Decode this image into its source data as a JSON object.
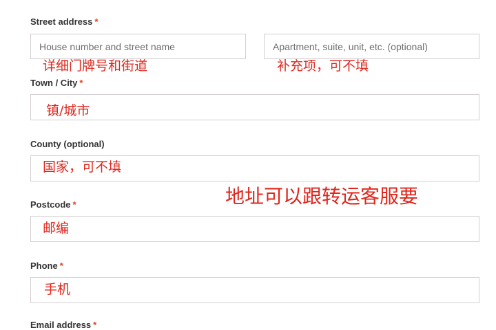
{
  "street": {
    "label": "Street address",
    "required_mark": "*",
    "line1_placeholder": "House number and street name",
    "line2_placeholder": "Apartment, suite, unit, etc. (optional)",
    "line1_note": "详细门牌号和街道",
    "line2_note": "补充项，可不填"
  },
  "town": {
    "label": "Town / City",
    "required_mark": "*",
    "note": "镇/城市"
  },
  "county": {
    "label": "County (optional)",
    "note": "国家，可不填"
  },
  "address_note": "地址可以跟转运客服要",
  "postcode": {
    "label": "Postcode",
    "required_mark": "*",
    "note": "邮编"
  },
  "phone": {
    "label": "Phone",
    "required_mark": "*",
    "note": "手机"
  },
  "email": {
    "label": "Email address",
    "required_mark": "*"
  },
  "colors": {
    "required_mark": "#e2401c",
    "annotation": "#e1251b",
    "field_border": "#d3ced2"
  }
}
